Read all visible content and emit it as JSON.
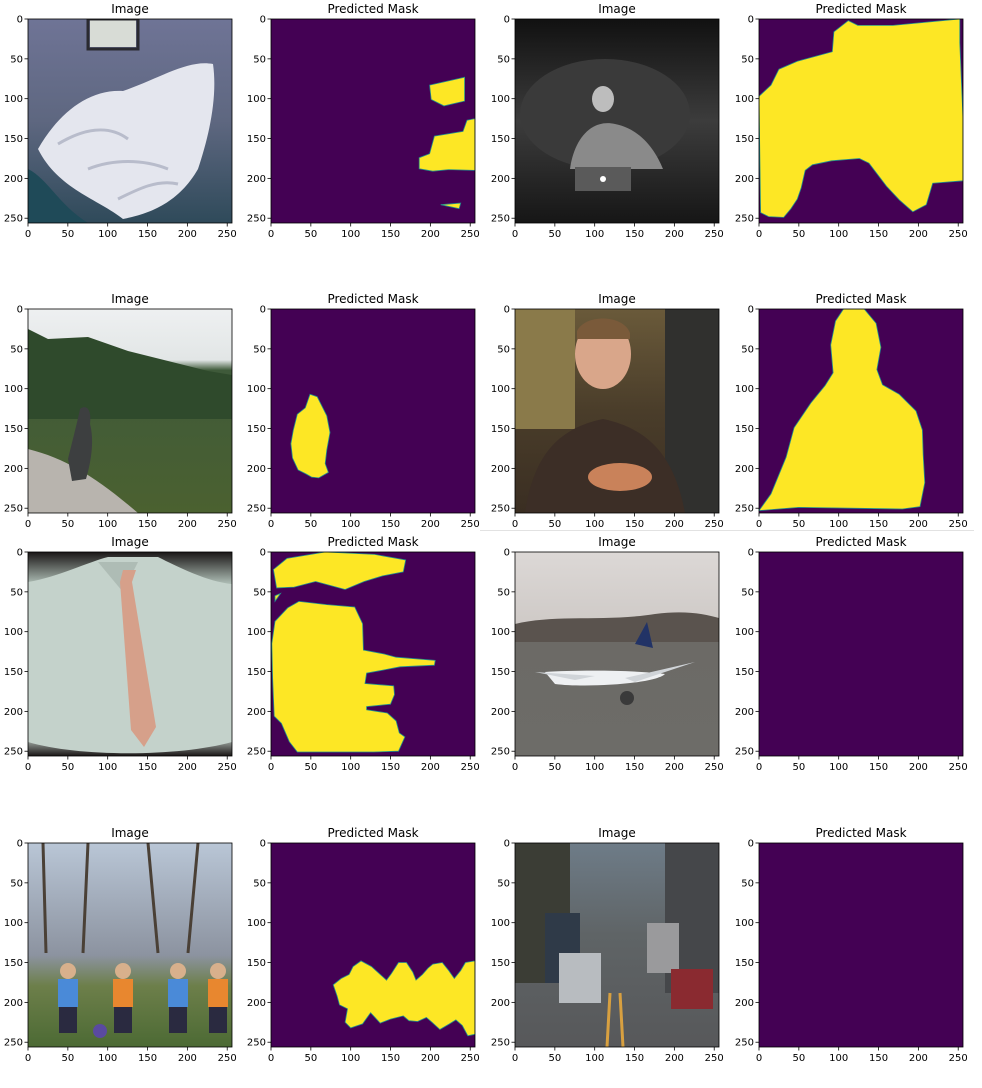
{
  "colors": {
    "mask_background": "#440154",
    "mask_foreground": "#fde725",
    "mask_edge": "#21918c"
  },
  "chart_data": [
    {
      "type": "image",
      "title": "Image",
      "scene": "bedroom-dress",
      "xlim": [
        0,
        256
      ],
      "ylim": [
        256,
        0
      ],
      "xticks": [
        0,
        50,
        100,
        150,
        200,
        250
      ],
      "yticks": [
        0,
        50,
        100,
        150,
        200,
        250
      ]
    },
    {
      "type": "heatmap",
      "title": "Predicted Mask",
      "xlim": [
        0,
        256
      ],
      "ylim": [
        256,
        0
      ],
      "xticks": [
        0,
        50,
        100,
        150,
        200,
        250
      ],
      "yticks": [
        0,
        50,
        100,
        150,
        200,
        250
      ],
      "regions": [
        [
          [
            199,
            83
          ],
          [
            243,
            73
          ],
          [
            243,
            103
          ],
          [
            217,
            109
          ],
          [
            201,
            101
          ]
        ],
        [
          [
            186,
            188
          ],
          [
            186,
            174
          ],
          [
            199,
            169
          ],
          [
            205,
            147
          ],
          [
            241,
            141
          ],
          [
            246,
            127
          ],
          [
            256,
            125
          ],
          [
            256,
            190
          ],
          [
            223,
            189
          ],
          [
            203,
            191
          ]
        ],
        [
          [
            213,
            233
          ],
          [
            238,
            231
          ],
          [
            236,
            238
          ]
        ]
      ]
    },
    {
      "type": "image",
      "title": "Image",
      "scene": "laptop-woman",
      "xlim": [
        0,
        256
      ],
      "ylim": [
        256,
        0
      ],
      "xticks": [
        0,
        50,
        100,
        150,
        200,
        250
      ],
      "yticks": [
        0,
        50,
        100,
        150,
        200,
        250
      ]
    },
    {
      "type": "heatmap",
      "title": "Predicted Mask",
      "xlim": [
        0,
        256
      ],
      "ylim": [
        256,
        0
      ],
      "xticks": [
        0,
        50,
        100,
        150,
        200,
        250
      ],
      "yticks": [
        0,
        50,
        100,
        150,
        200,
        250
      ],
      "regions": [
        [
          [
            0,
            97
          ],
          [
            15,
            83
          ],
          [
            25,
            63
          ],
          [
            48,
            53
          ],
          [
            92,
            41
          ],
          [
            94,
            16
          ],
          [
            112,
            2
          ],
          [
            124,
            8
          ],
          [
            168,
            8
          ],
          [
            252,
            0
          ],
          [
            252,
            30
          ],
          [
            256,
            125
          ],
          [
            256,
            203
          ],
          [
            218,
            206
          ],
          [
            210,
            233
          ],
          [
            193,
            242
          ],
          [
            176,
            227
          ],
          [
            160,
            210
          ],
          [
            138,
            181
          ],
          [
            126,
            175
          ],
          [
            91,
            178
          ],
          [
            67,
            183
          ],
          [
            58,
            190
          ],
          [
            53,
            212
          ],
          [
            48,
            226
          ],
          [
            40,
            238
          ],
          [
            31,
            249
          ],
          [
            12,
            248
          ],
          [
            2,
            243
          ]
        ]
      ]
    },
    {
      "type": "image",
      "title": "Image",
      "scene": "hiker-forest",
      "xlim": [
        0,
        256
      ],
      "ylim": [
        256,
        0
      ],
      "xticks": [
        0,
        50,
        100,
        150,
        200,
        250
      ],
      "yticks": [
        0,
        50,
        100,
        150,
        200,
        250
      ]
    },
    {
      "type": "heatmap",
      "title": "Predicted Mask",
      "xlim": [
        0,
        256
      ],
      "ylim": [
        256,
        0
      ],
      "xticks": [
        0,
        50,
        100,
        150,
        200,
        250
      ],
      "yticks": [
        0,
        50,
        100,
        150,
        200,
        250
      ],
      "regions": [
        [
          [
            28,
            152
          ],
          [
            33,
            132
          ],
          [
            43,
            124
          ],
          [
            49,
            107
          ],
          [
            58,
            110
          ],
          [
            65,
            124
          ],
          [
            70,
            134
          ],
          [
            74,
            155
          ],
          [
            70,
            177
          ],
          [
            68,
            194
          ],
          [
            72,
            205
          ],
          [
            60,
            212
          ],
          [
            51,
            211
          ],
          [
            44,
            207
          ],
          [
            34,
            202
          ],
          [
            27,
            187
          ],
          [
            25,
            169
          ]
        ]
      ]
    },
    {
      "type": "image",
      "title": "Image",
      "scene": "man-pizza",
      "xlim": [
        0,
        256
      ],
      "ylim": [
        256,
        0
      ],
      "xticks": [
        0,
        50,
        100,
        150,
        200,
        250
      ],
      "yticks": [
        0,
        50,
        100,
        150,
        200,
        250
      ]
    },
    {
      "type": "heatmap",
      "title": "Predicted Mask",
      "xlim": [
        0,
        256
      ],
      "ylim": [
        256,
        0
      ],
      "xticks": [
        0,
        50,
        100,
        150,
        200,
        250
      ],
      "yticks": [
        0,
        50,
        100,
        150,
        200,
        250
      ],
      "regions": [
        [
          [
            0,
            253
          ],
          [
            15,
            232
          ],
          [
            34,
            186
          ],
          [
            44,
            149
          ],
          [
            65,
            118
          ],
          [
            83,
            96
          ],
          [
            93,
            80
          ],
          [
            90,
            45
          ],
          [
            96,
            15
          ],
          [
            106,
            0
          ],
          [
            132,
            0
          ],
          [
            147,
            18
          ],
          [
            153,
            48
          ],
          [
            148,
            76
          ],
          [
            155,
            95
          ],
          [
            176,
            107
          ],
          [
            197,
            128
          ],
          [
            205,
            152
          ],
          [
            206,
            183
          ],
          [
            208,
            218
          ],
          [
            202,
            248
          ],
          [
            180,
            251
          ],
          [
            50,
            249
          ]
        ]
      ]
    },
    {
      "type": "image",
      "title": "Image",
      "scene": "shirt-tie",
      "xlim": [
        0,
        256
      ],
      "ylim": [
        256,
        0
      ],
      "xticks": [
        0,
        50,
        100,
        150,
        200,
        250
      ],
      "yticks": [
        0,
        50,
        100,
        150,
        200,
        250
      ]
    },
    {
      "type": "heatmap",
      "title": "Predicted Mask",
      "xlim": [
        0,
        256
      ],
      "ylim": [
        256,
        0
      ],
      "xticks": [
        0,
        50,
        100,
        150,
        200,
        250
      ],
      "yticks": [
        0,
        50,
        100,
        150,
        200,
        250
      ],
      "regions": [
        [
          [
            3,
            22
          ],
          [
            20,
            8
          ],
          [
            68,
            0
          ],
          [
            130,
            3
          ],
          [
            169,
            10
          ],
          [
            166,
            25
          ],
          [
            140,
            30
          ],
          [
            117,
            37
          ],
          [
            93,
            47
          ],
          [
            56,
            37
          ],
          [
            29,
            44
          ],
          [
            7,
            45
          ]
        ],
        [
          [
            5,
            55
          ],
          [
            12,
            52
          ],
          [
            5,
            62
          ]
        ],
        [
          [
            5,
            87
          ],
          [
            21,
            70
          ],
          [
            35,
            62
          ],
          [
            70,
            66
          ],
          [
            105,
            69
          ],
          [
            115,
            90
          ],
          [
            116,
            123
          ],
          [
            142,
            128
          ],
          [
            157,
            132
          ],
          [
            206,
            136
          ],
          [
            205,
            142
          ],
          [
            162,
            144
          ],
          [
            142,
            148
          ],
          [
            120,
            152
          ],
          [
            118,
            165
          ],
          [
            154,
            168
          ],
          [
            155,
            179
          ],
          [
            150,
            191
          ],
          [
            120,
            194
          ],
          [
            120,
            198
          ],
          [
            146,
            202
          ],
          [
            157,
            212
          ],
          [
            161,
            227
          ],
          [
            168,
            232
          ],
          [
            160,
            250
          ],
          [
            129,
            251
          ],
          [
            33,
            251
          ],
          [
            23,
            238
          ],
          [
            13,
            215
          ],
          [
            4,
            206
          ],
          [
            2,
            158
          ],
          [
            1,
            115
          ]
        ]
      ]
    },
    {
      "type": "image",
      "title": "Image",
      "scene": "airplane-runway",
      "xlim": [
        0,
        256
      ],
      "ylim": [
        256,
        0
      ],
      "xticks": [
        0,
        50,
        100,
        150,
        200,
        250
      ],
      "yticks": [
        0,
        50,
        100,
        150,
        200,
        250
      ]
    },
    {
      "type": "heatmap",
      "title": "Predicted Mask",
      "xlim": [
        0,
        256
      ],
      "ylim": [
        256,
        0
      ],
      "xticks": [
        0,
        50,
        100,
        150,
        200,
        250
      ],
      "yticks": [
        0,
        50,
        100,
        150,
        200,
        250
      ],
      "regions": []
    },
    {
      "type": "image",
      "title": "Image",
      "scene": "kids-soccer",
      "xlim": [
        0,
        256
      ],
      "ylim": [
        256,
        0
      ],
      "xticks": [
        0,
        50,
        100,
        150,
        200,
        250
      ],
      "yticks": [
        0,
        50,
        100,
        150,
        200,
        250
      ]
    },
    {
      "type": "heatmap",
      "title": "Predicted Mask",
      "xlim": [
        0,
        256
      ],
      "ylim": [
        256,
        0
      ],
      "xticks": [
        0,
        50,
        100,
        150,
        200,
        250
      ],
      "yticks": [
        0,
        50,
        100,
        150,
        200,
        250
      ],
      "regions": [
        [
          [
            78,
            178
          ],
          [
            88,
            170
          ],
          [
            98,
            165
          ],
          [
            103,
            155
          ],
          [
            113,
            148
          ],
          [
            126,
            155
          ],
          [
            136,
            164
          ],
          [
            145,
            172
          ],
          [
            151,
            164
          ],
          [
            160,
            150
          ],
          [
            170,
            150
          ],
          [
            178,
            162
          ],
          [
            182,
            172
          ],
          [
            190,
            165
          ],
          [
            197,
            157
          ],
          [
            203,
            152
          ],
          [
            215,
            150
          ],
          [
            223,
            160
          ],
          [
            230,
            170
          ],
          [
            238,
            160
          ],
          [
            244,
            150
          ],
          [
            256,
            148
          ],
          [
            256,
            240
          ],
          [
            247,
            242
          ],
          [
            240,
            229
          ],
          [
            232,
            222
          ],
          [
            224,
            227
          ],
          [
            212,
            234
          ],
          [
            202,
            225
          ],
          [
            195,
            219
          ],
          [
            184,
            224
          ],
          [
            173,
            223
          ],
          [
            166,
            217
          ],
          [
            150,
            221
          ],
          [
            137,
            226
          ],
          [
            125,
            213
          ],
          [
            115,
            227
          ],
          [
            100,
            232
          ],
          [
            93,
            225
          ],
          [
            96,
            208
          ],
          [
            86,
            203
          ],
          [
            83,
            192
          ]
        ]
      ]
    },
    {
      "type": "image",
      "title": "Image",
      "scene": "city-street",
      "xlim": [
        0,
        256
      ],
      "ylim": [
        256,
        0
      ],
      "xticks": [
        0,
        50,
        100,
        150,
        200,
        250
      ],
      "yticks": [
        0,
        50,
        100,
        150,
        200,
        250
      ]
    },
    {
      "type": "heatmap",
      "title": "Predicted Mask",
      "xlim": [
        0,
        256
      ],
      "ylim": [
        256,
        0
      ],
      "xticks": [
        0,
        50,
        100,
        150,
        200,
        250
      ],
      "yticks": [
        0,
        50,
        100,
        150,
        200,
        250
      ],
      "regions": []
    }
  ]
}
